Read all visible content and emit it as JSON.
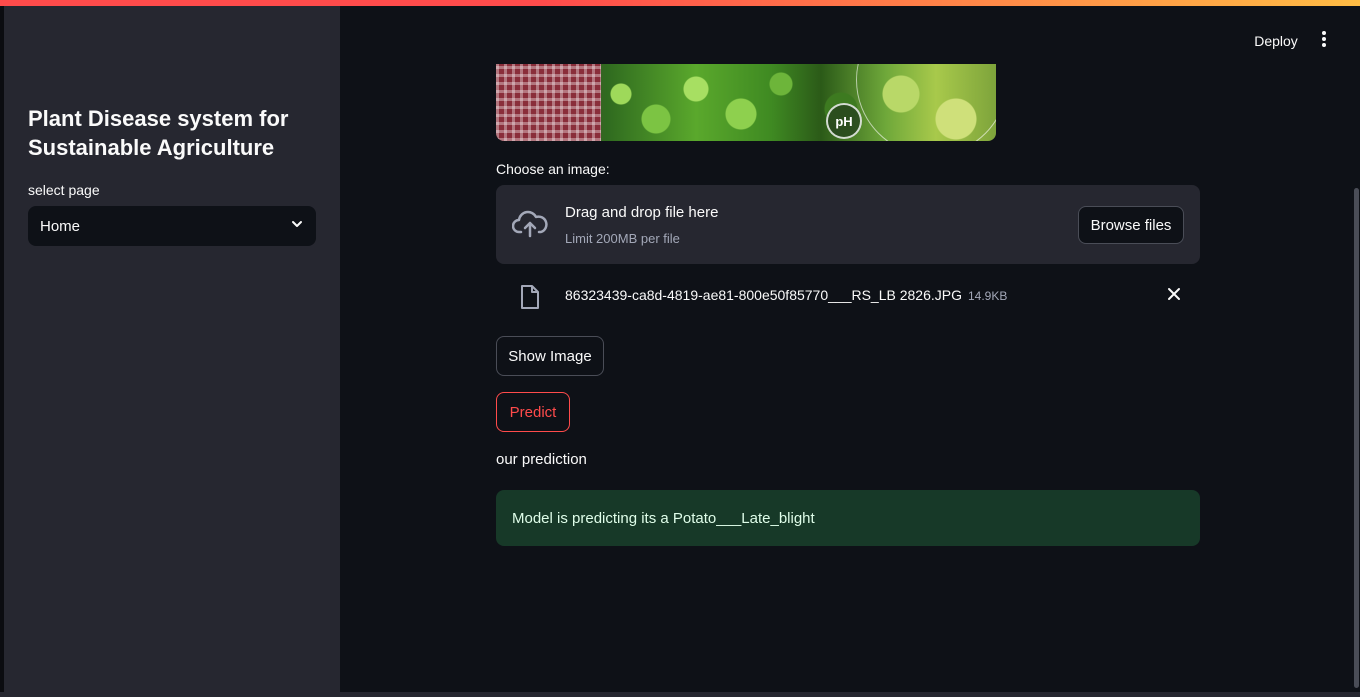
{
  "app": {
    "accent_gradient": [
      "#ff4b4b",
      "#ffbd45"
    ],
    "background": "#0e1117",
    "sidebar_background": "#262730"
  },
  "header": {
    "deploy_label": "Deploy",
    "menu_icon": "vertical-dots-icon"
  },
  "sidebar": {
    "title": "Plant Disease system for Sustainable Agriculture",
    "select_label": "select page",
    "selected_page": "Home",
    "chevron_icon": "chevron-down-icon"
  },
  "main": {
    "banner": {
      "badge_text": "pH"
    },
    "uploader": {
      "label": "Choose an image:",
      "dropzone_title": "Drag and drop file here",
      "dropzone_limit": "Limit 200MB per file",
      "browse_label": "Browse files",
      "upload_icon": "cloud-upload-icon"
    },
    "uploaded_file": {
      "name": "86323439-ca8d-4819-ae81-800e50f85770___RS_LB 2826.JPG",
      "size": "14.9KB",
      "file_icon": "file-icon",
      "remove_icon": "close-icon"
    },
    "show_image_label": "Show Image",
    "predict_label": "Predict",
    "prediction_heading": "our prediction",
    "prediction_result": "Model is predicting its a Potato___Late_blight",
    "success_color": "#173928",
    "predict_color": "#ff4b4b"
  }
}
